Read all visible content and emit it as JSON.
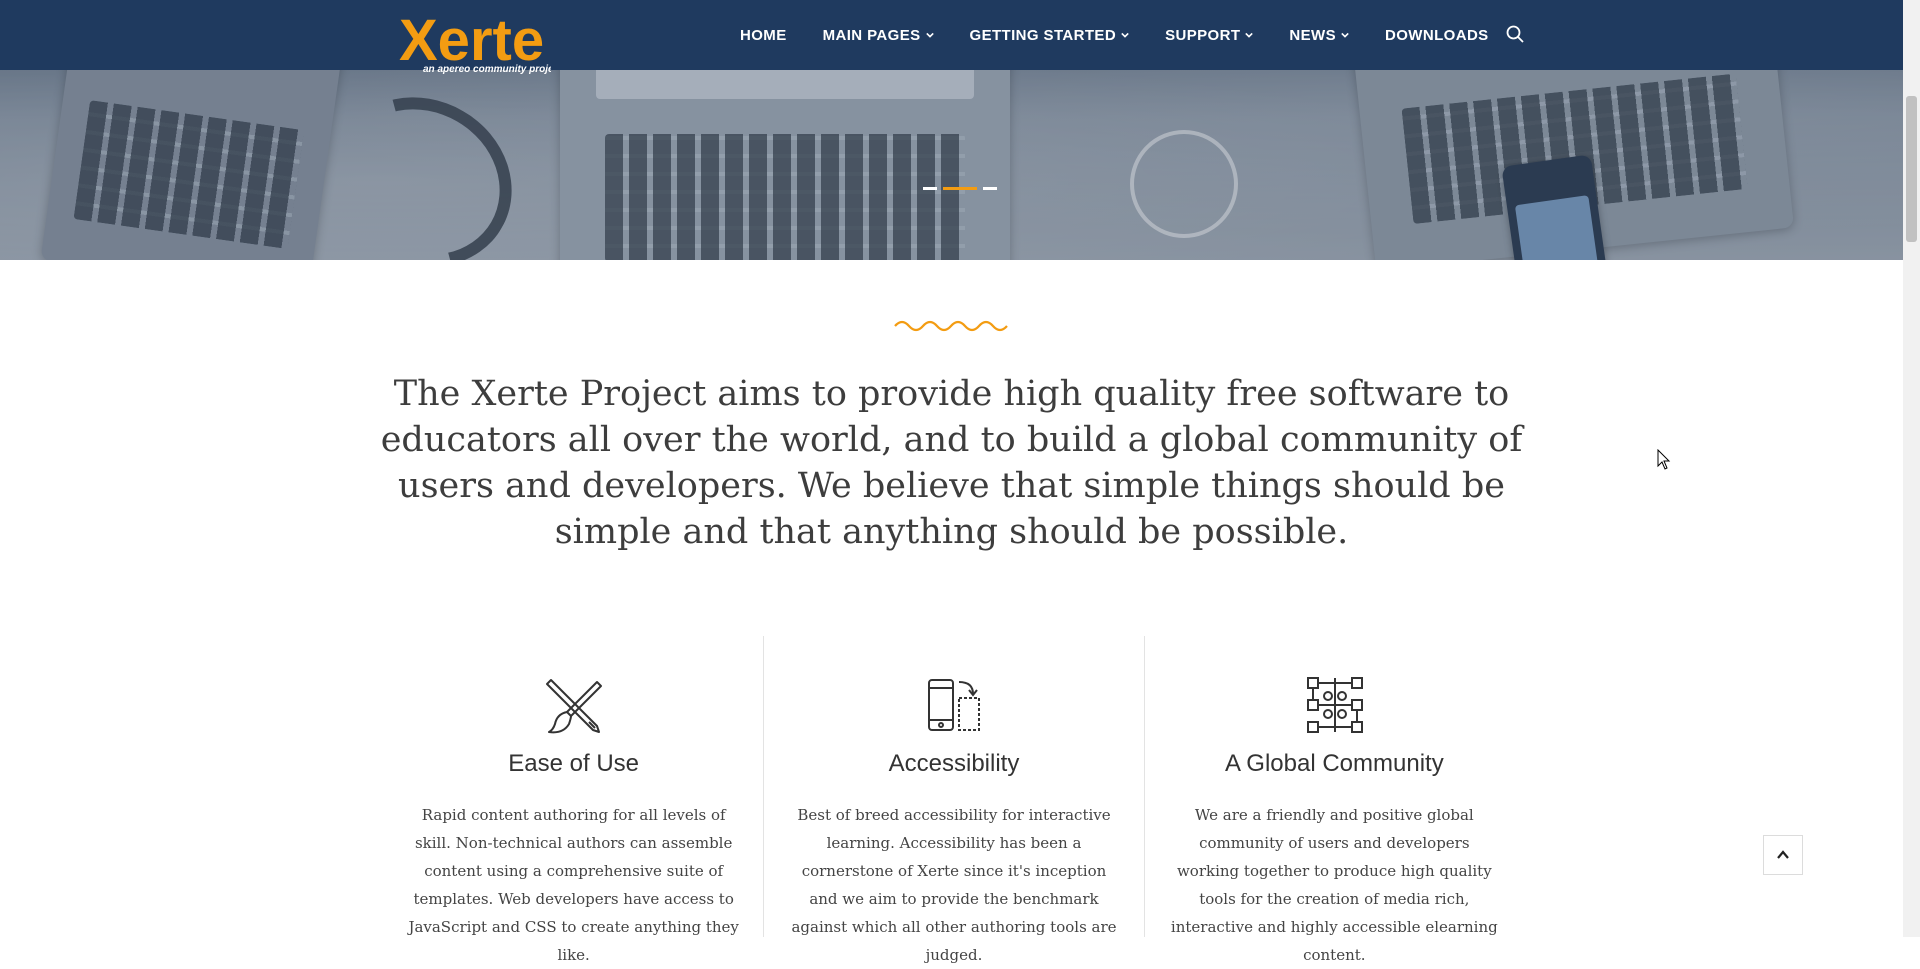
{
  "logo": {
    "word": "Xerte",
    "tagline": "an apereo community project"
  },
  "nav": {
    "items": [
      {
        "label": "HOME",
        "has_dropdown": false
      },
      {
        "label": "MAIN PAGES",
        "has_dropdown": true
      },
      {
        "label": "GETTING STARTED",
        "has_dropdown": true
      },
      {
        "label": "SUPPORT",
        "has_dropdown": true
      },
      {
        "label": "NEWS",
        "has_dropdown": true
      },
      {
        "label": "DOWNLOADS",
        "has_dropdown": false
      }
    ],
    "search_icon": "search-icon"
  },
  "slider": {
    "slides": 3,
    "active_slide": 2
  },
  "mission": "The Xerte Project aims to provide high quality free software to educators all over the world, and to build a global community of users and developers. We believe that simple things should be simple and that anything should be possible.",
  "features": [
    {
      "icon": "pencil-brush-icon",
      "title": "Ease of Use",
      "text": "Rapid content authoring for all levels of skill. Non-technical authors can assemble content using a comprehensive suite of templates. Web developers have access to JavaScript and CSS to create anything they like."
    },
    {
      "icon": "responsive-devices-icon",
      "title": "Accessibility",
      "text": "Best of breed accessibility for interactive learning. Accessibility has been a cornerstone of Xerte since it's inception and we aim to provide the benchmark against which all other authoring tools are judged."
    },
    {
      "icon": "network-nodes-icon",
      "title": "A Global Community",
      "text": "We are a friendly and positive global community of users and developers working together to produce high quality tools for the creation of media rich, interactive and highly accessible elearning content."
    }
  ],
  "colors": {
    "header_bg": "#1f3a5f",
    "accent": "#f39c12",
    "text": "#3d3d3d"
  }
}
